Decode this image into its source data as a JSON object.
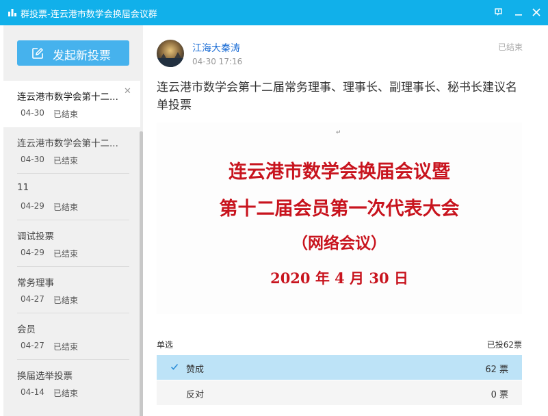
{
  "window": {
    "title": "群投票-连云港市数学会换届会议群",
    "accent_color": "#11b0ea"
  },
  "sidebar": {
    "new_vote_label": "发起新投票",
    "items": [
      {
        "title": "连云港市数学会第十二...",
        "date": "04-30",
        "status": "已结束"
      },
      {
        "title": "连云港市数学会第十二...",
        "date": "04-30",
        "status": "已结束"
      },
      {
        "title": "11",
        "date": "04-29",
        "status": "已结束"
      },
      {
        "title": "调试投票",
        "date": "04-29",
        "status": "已结束"
      },
      {
        "title": "常务理事",
        "date": "04-27",
        "status": "已结束"
      },
      {
        "title": "会员",
        "date": "04-27",
        "status": "已结束"
      },
      {
        "title": "换届选举投票",
        "date": "04-14",
        "status": "已结束"
      }
    ]
  },
  "post": {
    "author": "江海大秦涛",
    "time": "04-30 17:16",
    "status": "已结束",
    "title": "连云港市数学会第十二届常务理事、理事长、副理事长、秘书长建议名单投票",
    "banner": {
      "line1": "连云港市数学会换届会议暨",
      "line2": "第十二届会员第一次代表大会",
      "line3": "（网络会议）",
      "line4": "2020 年 4 月 30 日"
    },
    "option_type": "单选",
    "vote_total": "已投62票",
    "options": [
      {
        "label": "赞成",
        "votes": "62 票",
        "selected": true
      },
      {
        "label": "反对",
        "votes": "0 票",
        "selected": false
      }
    ]
  }
}
